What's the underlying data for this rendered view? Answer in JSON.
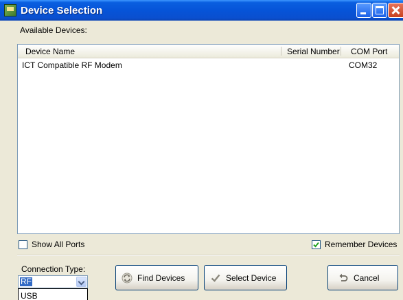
{
  "window": {
    "title": "Device Selection"
  },
  "devices": {
    "label": "Available Devices:",
    "columns": {
      "name": "Device Name",
      "serial": "Serial Number",
      "port": "COM Port"
    },
    "rows": [
      {
        "name": "ICT Compatible RF Modem",
        "serial": "",
        "port": "COM32"
      }
    ]
  },
  "options": {
    "show_all_ports": {
      "label": "Show All Ports",
      "checked": false
    },
    "remember_devices": {
      "label": "Remember Devices",
      "checked": true
    }
  },
  "connection": {
    "label": "Connection Type:",
    "selected": "RF",
    "dropdown_option": "USB"
  },
  "buttons": {
    "find": "Find Devices",
    "select": "Select Device",
    "cancel": "Cancel"
  },
  "colors": {
    "titlebar": "#0654d8",
    "selection": "#316ac5",
    "check": "#21a121"
  }
}
